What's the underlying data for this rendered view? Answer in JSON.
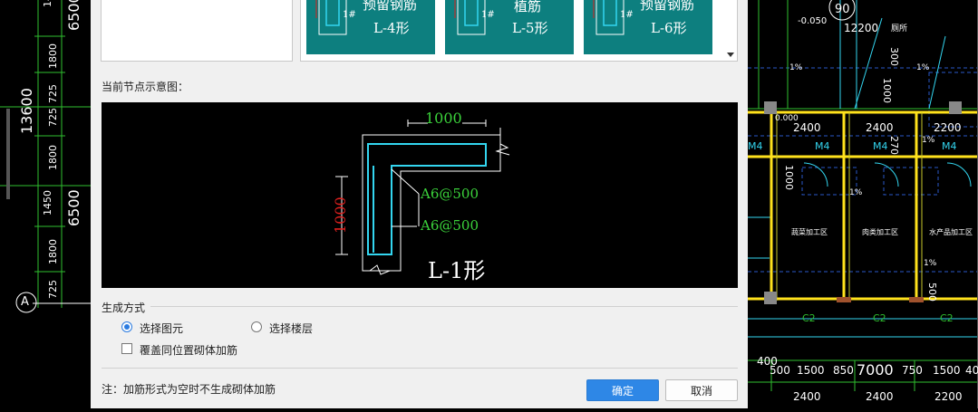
{
  "cad_left": {
    "dims": [
      "1450",
      "6500",
      "1800",
      "725",
      "725",
      "13600",
      "1800",
      "6500",
      "1450",
      "6500",
      "1800",
      "725"
    ],
    "axis_label": "A"
  },
  "dialog": {
    "thumbnails": [
      {
        "title": "预留钢筋",
        "sub": "L-4形",
        "mark": "1#"
      },
      {
        "title": "植筋",
        "sub": "L-5形",
        "mark": "1#"
      },
      {
        "title": "预留钢筋",
        "sub": "L-6形",
        "mark": "1#"
      }
    ],
    "preview_label": "当前节点示意图：",
    "diagram": {
      "top_dim": "1000",
      "side_dim": "1000",
      "rebar1": "A6@500",
      "rebar2": "A6@500",
      "shape": "L-1形"
    },
    "generate_section": "生成方式",
    "radio_select_element": "选择图元",
    "radio_select_floor": "选择楼层",
    "checkbox_overwrite": "覆盖同位置砌体加筋",
    "note": "注：加筋形式为空时不生成砌体加筋",
    "ok_label": "确定",
    "cancel_label": "取消"
  },
  "cad_right": {
    "elev": "-0.050",
    "circle_num": "90",
    "top_len": "12200",
    "room_top": "厕所",
    "dims_row1": [
      "0.000",
      "2400",
      "2400",
      "2200"
    ],
    "door_labels": [
      "M4",
      "M4",
      "M4",
      "M4"
    ],
    "v_dims": [
      "300",
      "1000",
      "270",
      "1000",
      "500"
    ],
    "percent": "1%",
    "rooms": [
      "蔬菜加工区",
      "肉类加工区",
      "水产品加工区"
    ],
    "c_labels": [
      "C2",
      "C2",
      "C2"
    ],
    "bottom_dims": [
      "400",
      "500",
      "1500",
      "850",
      "7000",
      "750",
      "1500",
      "400"
    ],
    "bottom_dims2": [
      "2400",
      "2400",
      "2200"
    ]
  },
  "colors": {
    "teal": "#0d7f7f",
    "cyan": "#33d6f0",
    "green_text": "#3bd23b",
    "red_text": "#e0201e",
    "yellow": "#ffe21c",
    "blue_btn": "#2e87e6"
  }
}
